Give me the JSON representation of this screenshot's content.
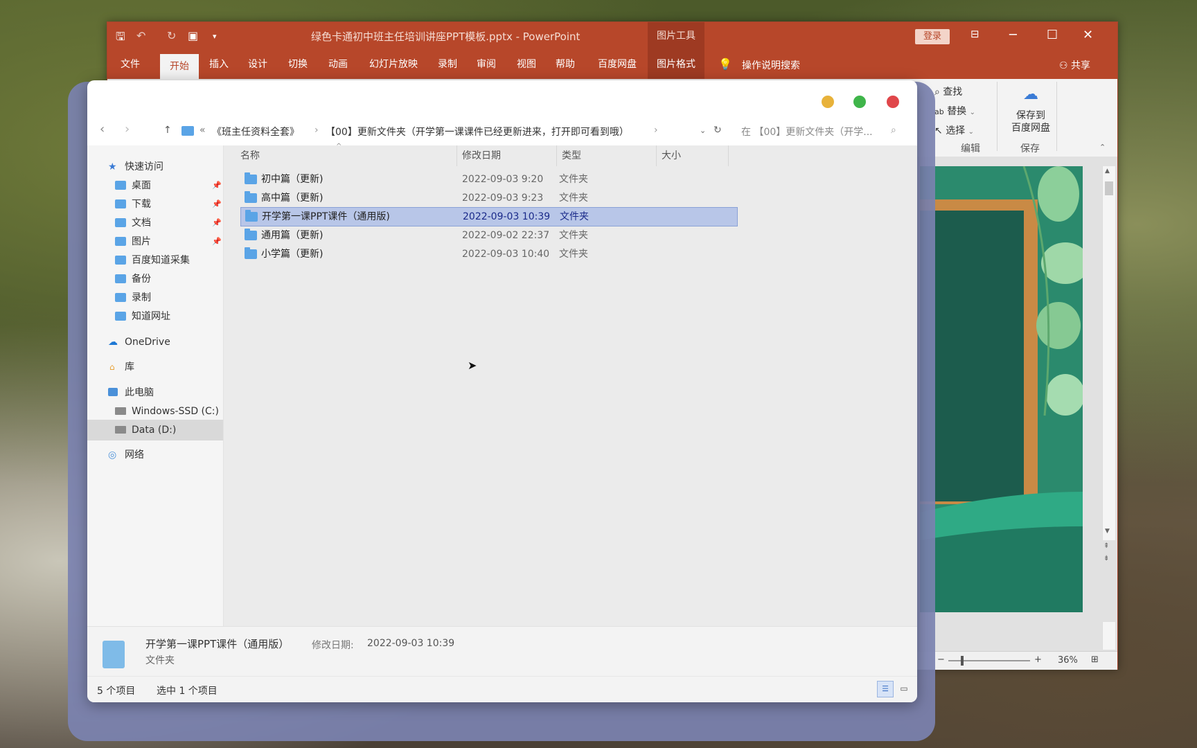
{
  "ppt": {
    "doc_title": "绿色卡通初中班主任培训讲座PPT模板.pptx  -  PowerPoint",
    "context_tools": "图片工具",
    "login": "登录",
    "share": "共享",
    "tabs": [
      "文件",
      "开始",
      "插入",
      "设计",
      "切换",
      "动画",
      "幻灯片放映",
      "录制",
      "审阅",
      "视图",
      "帮助",
      "百度网盘",
      "图片格式"
    ],
    "tell_me": "操作说明搜索",
    "ribbon": {
      "find": "查找",
      "replace": "替换",
      "select": "选择",
      "edit_group": "编辑",
      "save_to": "保存到",
      "baidu_pan": "百度网盘",
      "save_group": "保存"
    },
    "zoom": "36%"
  },
  "explorer": {
    "breadcrumb": {
      "overflow": "«",
      "parent": "《班主任资料全套》",
      "current": "【00】更新文件夹（开学第一课课件已经更新进来，打开即可看到哦）"
    },
    "search_placeholder": "在 【00】更新文件夹（开学...",
    "nav": {
      "quick_access": "快速访问",
      "desktop": "桌面",
      "downloads": "下载",
      "documents": "文档",
      "pictures": "图片",
      "baidu_zhidao": "百度知道采集",
      "backup": "备份",
      "record": "录制",
      "zhidao_url": "知道网址",
      "onedrive": "OneDrive",
      "library": "库",
      "this_pc": "此电脑",
      "drive_c": "Windows-SSD (C:)",
      "drive_d": "Data (D:)",
      "network": "网络"
    },
    "columns": {
      "name": "名称",
      "date": "修改日期",
      "type": "类型",
      "size": "大小"
    },
    "files": [
      {
        "name": "初中篇（更新)",
        "date": "2022-09-03 9:20",
        "type": "文件夹"
      },
      {
        "name": "高中篇（更新)",
        "date": "2022-09-03 9:23",
        "type": "文件夹"
      },
      {
        "name": "开学第一课PPT课件（通用版)",
        "date": "2022-09-03 10:39",
        "type": "文件夹"
      },
      {
        "name": "通用篇（更新)",
        "date": "2022-09-02 22:37",
        "type": "文件夹"
      },
      {
        "name": "小学篇（更新)",
        "date": "2022-09-03 10:40",
        "type": "文件夹"
      }
    ],
    "details": {
      "name": "开学第一课PPT课件（通用版）",
      "date_label": "修改日期:",
      "date": "2022-09-03 10:39",
      "type": "文件夹"
    },
    "status": {
      "count": "5 个项目",
      "selected": "选中 1 个项目"
    },
    "colors": {
      "close": "#e0464a",
      "max": "#3fb54a",
      "min": "#e8b23a",
      "selection": "#b8c6e8"
    }
  }
}
